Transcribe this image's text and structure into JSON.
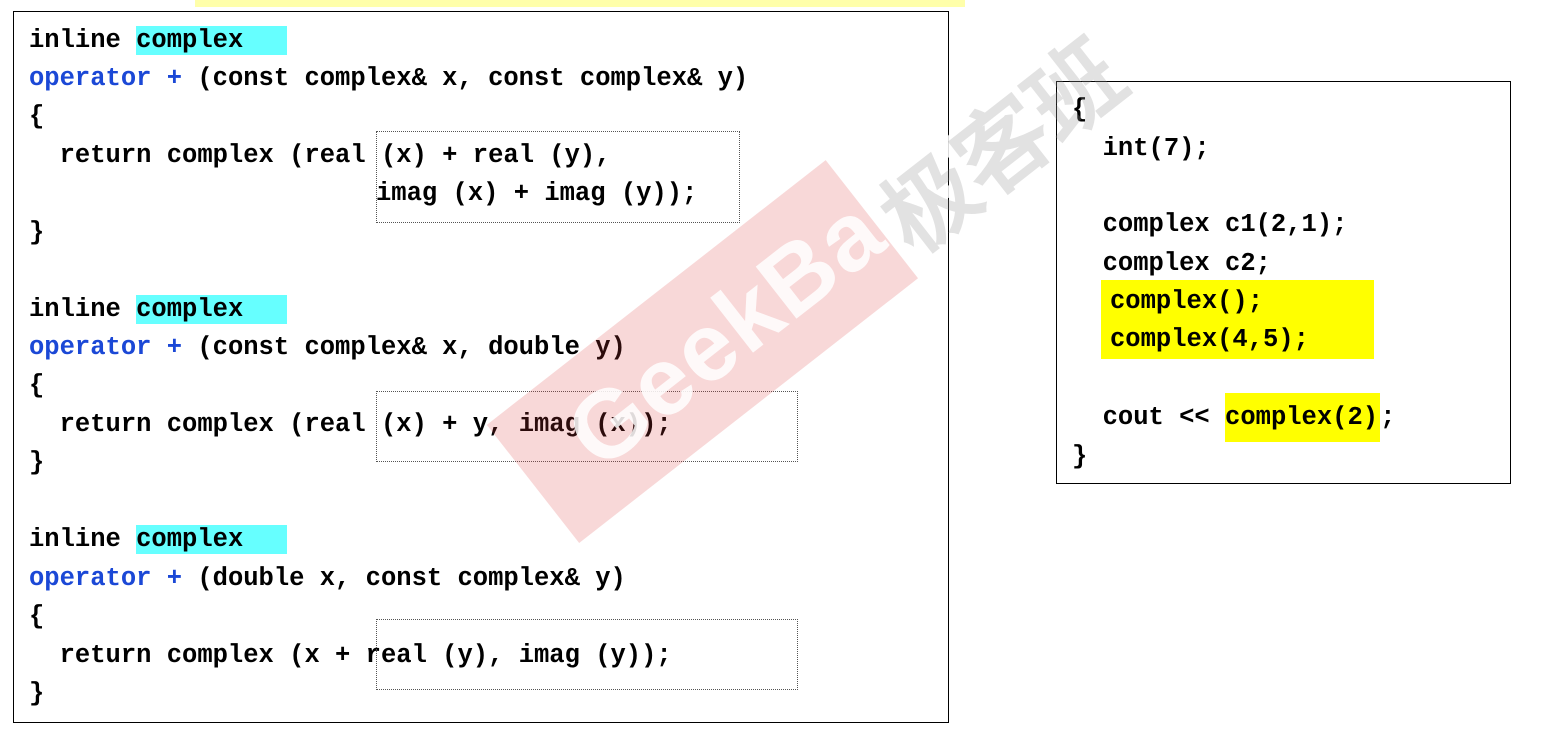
{
  "left_code": {
    "block1": {
      "l1_kw": "inline ",
      "l1_type": "complex",
      "l2_kw": "operator +",
      "l2_rest": " (const complex& x, const complex& y)",
      "l3": "{",
      "l4_pre": "  return complex (",
      "l4_boxed": "real (x) + real (y)",
      "l4_post": ",",
      "l5_boxed": "imag (x) + imag (y)",
      "l5_post": ");",
      "l6": "}"
    },
    "block2": {
      "l1_kw": "inline ",
      "l1_type": "complex",
      "l2_kw": "operator +",
      "l2_rest": " (const complex& x, double y)",
      "l3": "{",
      "l4_pre": "  return complex (",
      "l4_boxed": "real (x) + y, imag (x)",
      "l4_post": ");",
      "l5": "}"
    },
    "block3": {
      "l1_kw": "inline ",
      "l1_type": "complex",
      "l2_kw": "operator +",
      "l2_rest": " (double x, const complex& y)",
      "l3": "{",
      "l4_pre": "  return complex (",
      "l4_boxed": "x + real (y), imag (y)",
      "l4_post": ");",
      "l5": "}"
    }
  },
  "right_code": {
    "open": "{",
    "int_line": "  int(7);",
    "c1_line": "  complex c1(2,1);",
    "c2_line": "  complex c2;",
    "temp1": "complex();",
    "temp2": "complex(4,5);",
    "cout_pre": "  cout << ",
    "cout_hl": "complex(2)",
    "cout_post": ";",
    "close": "}"
  },
  "watermark": {
    "latin": "GeekBand",
    "cjk": "极客班"
  },
  "colors": {
    "keyword_blue": "#1b48d6",
    "highlight_cyan": "#66ffff",
    "highlight_yellow": "#ffff00",
    "watermark_red": "#dc3c3c"
  }
}
